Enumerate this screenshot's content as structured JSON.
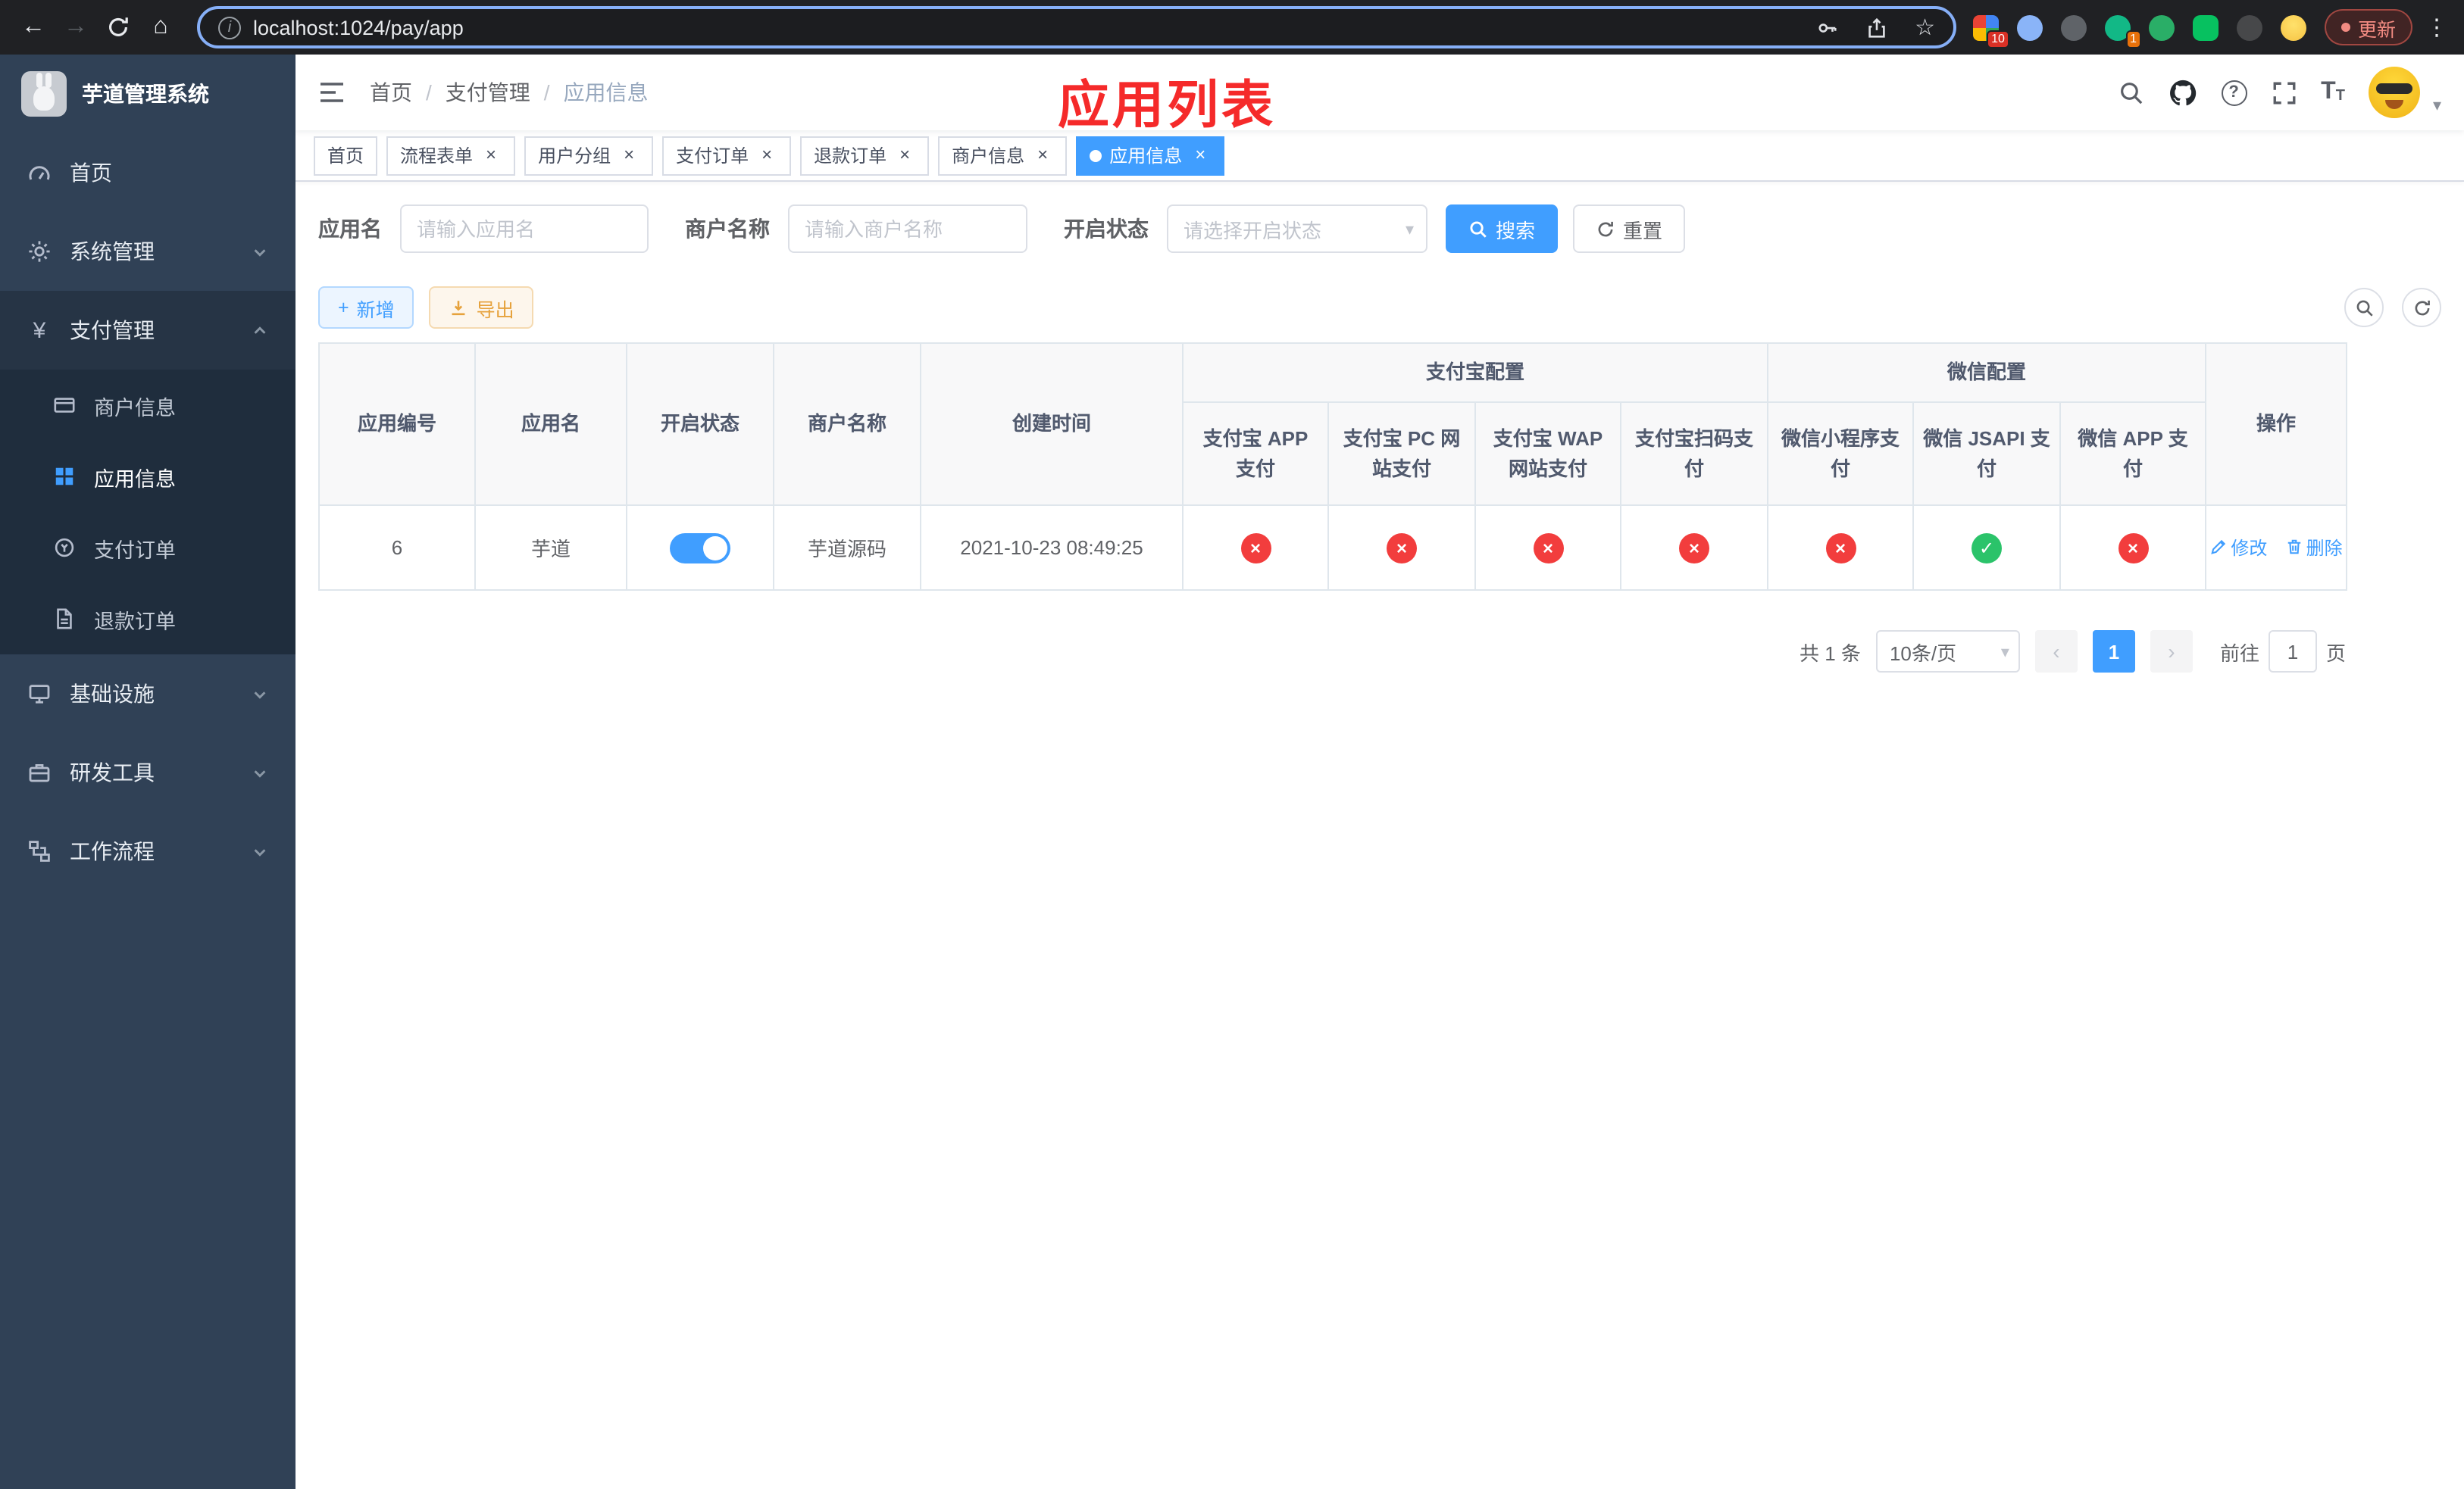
{
  "colors": {
    "primary": "#409eff",
    "danger": "#f23d3d",
    "success": "#2bc36a"
  },
  "browser": {
    "url": "localhost:1024/pay/app",
    "update_label": "更新",
    "extension_badge_count": "10",
    "profile_badge_count": "1"
  },
  "annotation": {
    "text": "应用列表",
    "color": "#f52a2a"
  },
  "sidebar": {
    "app_title": "芋道管理系统",
    "items": {
      "home": "首页",
      "system": "系统管理",
      "payment": "支付管理",
      "infra": "基础设施",
      "devtools": "研发工具",
      "workflow": "工作流程"
    },
    "payment_children": {
      "merchant": "商户信息",
      "app": "应用信息",
      "pay_order": "支付订单",
      "refund_order": "退款订单"
    }
  },
  "breadcrumb": [
    "首页",
    "支付管理",
    "应用信息"
  ],
  "tabs": [
    {
      "label": "首页",
      "closable": false,
      "active": false
    },
    {
      "label": "流程表单",
      "closable": true,
      "active": false
    },
    {
      "label": "用户分组",
      "closable": true,
      "active": false
    },
    {
      "label": "支付订单",
      "closable": true,
      "active": false
    },
    {
      "label": "退款订单",
      "closable": true,
      "active": false
    },
    {
      "label": "商户信息",
      "closable": true,
      "active": false
    },
    {
      "label": "应用信息",
      "closable": true,
      "active": true
    }
  ],
  "filters": {
    "app_name_label": "应用名",
    "app_name_placeholder": "请输入应用名",
    "merchant_label": "商户名称",
    "merchant_placeholder": "请输入商户名称",
    "status_label": "开启状态",
    "status_placeholder": "请选择开启状态",
    "search_label": "搜索",
    "reset_label": "重置"
  },
  "toolbar": {
    "add_label": "新增",
    "export_label": "导出"
  },
  "table": {
    "headers": {
      "app_id": "应用编号",
      "app_name": "应用名",
      "status": "开启状态",
      "merchant": "商户名称",
      "create_time": "创建时间",
      "alipay_group": "支付宝配置",
      "wechat_group": "微信配置",
      "actions": "操作",
      "alipay_app": "支付宝 APP 支付",
      "alipay_pc": "支付宝 PC 网站支付",
      "alipay_wap": "支付宝 WAP 网站支付",
      "alipay_qr": "支付宝扫码支付",
      "wx_lite": "微信小程序支付",
      "wx_jsapi": "微信 JSAPI 支付",
      "wx_app": "微信 APP 支付"
    },
    "row": {
      "app_id": "6",
      "app_name": "芋道",
      "status_on": true,
      "merchant": "芋道源码",
      "create_time": "2021-10-23 08:49:25",
      "channels": [
        "fail",
        "fail",
        "fail",
        "fail",
        "fail",
        "pass",
        "fail"
      ],
      "edit_label": "修改",
      "delete_label": "删除"
    }
  },
  "pagination": {
    "total": "共 1 条",
    "page_size": "10条/页",
    "current_page": "1",
    "goto_prefix": "前往",
    "goto_value": "1",
    "goto_suffix": "页"
  },
  "icons": {
    "back": "←",
    "forward": "→",
    "home": "⌂",
    "star": "☆",
    "info": "i",
    "kebab": "⋮",
    "close": "×",
    "check": "✓",
    "cross": "×",
    "plus": "+",
    "caret": "▾",
    "prev": "‹",
    "next": "›",
    "question": "?",
    "yen": "¥",
    "font_large": "T",
    "font_small": "T"
  }
}
